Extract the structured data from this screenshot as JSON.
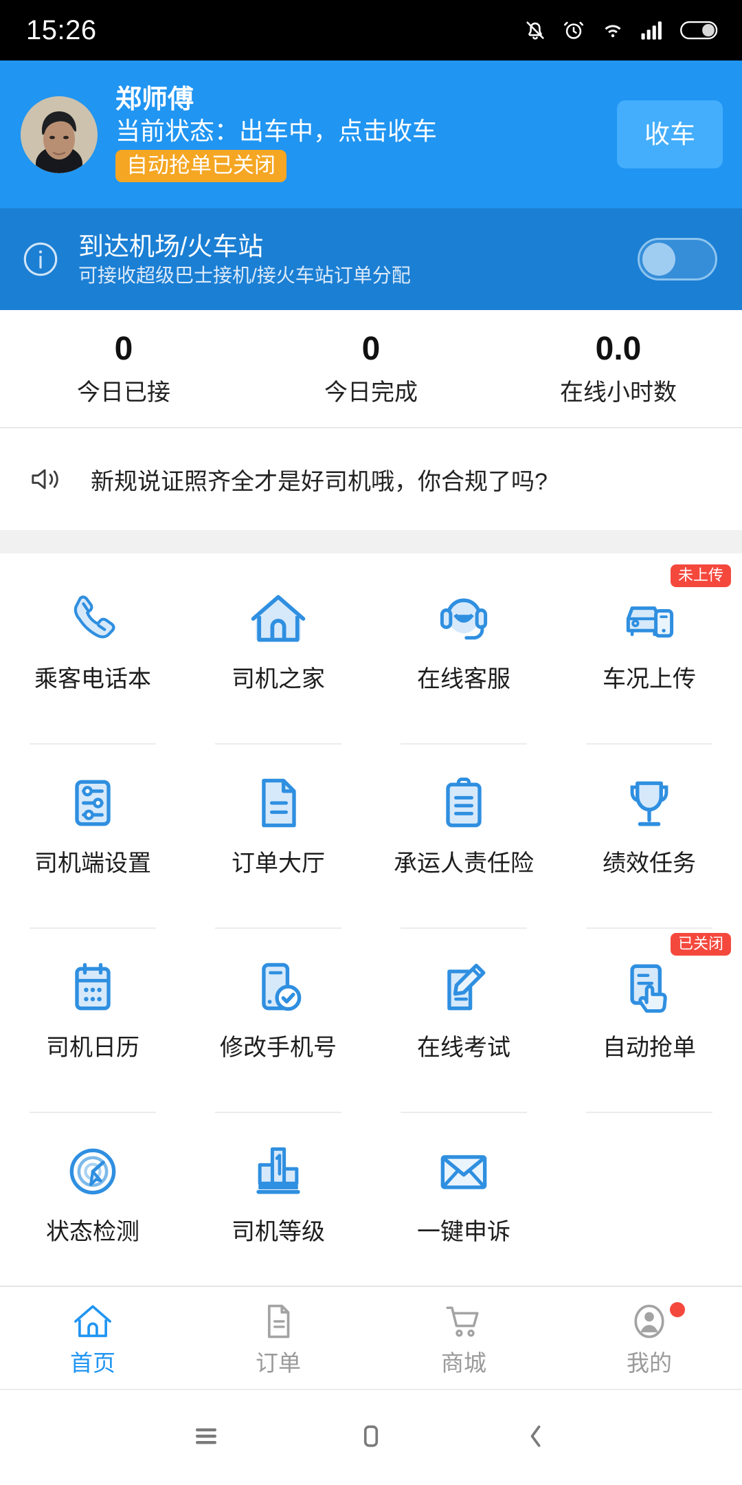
{
  "statusbar": {
    "clock": "15:26",
    "icons": [
      "bell-muted-icon",
      "alarm-clock-icon",
      "wifi-icon",
      "signal-bars-icon",
      "battery-icon"
    ]
  },
  "driver_header": {
    "name": "郑师傅",
    "status_text": "当前状态：出车中，点击收车",
    "auto_grab_badge": "自动抢单已关闭",
    "collect_button": "收车",
    "background_color": "#2095f2",
    "badge_color": "#f5a623"
  },
  "airport_banner": {
    "title": "到达机场/火车站",
    "subtitle": "可接收超级巴士接机/接火车站订单分配",
    "toggle_on": false,
    "background_color": "#1b7fd4"
  },
  "stats": [
    {
      "value": "0",
      "label": "今日已接"
    },
    {
      "value": "0",
      "label": "今日完成"
    },
    {
      "value": "0.0",
      "label": "在线小时数"
    }
  ],
  "announcement": {
    "icon": "speaker-icon",
    "text": "新规说证照齐全才是好司机哦，你合规了吗?"
  },
  "grid": [
    {
      "label": "乘客电话本",
      "icon": "phone-icon",
      "tag": null
    },
    {
      "label": "司机之家",
      "icon": "home-icon",
      "tag": null
    },
    {
      "label": "在线客服",
      "icon": "headset-icon",
      "tag": null
    },
    {
      "label": "车况上传",
      "icon": "car-upload-icon",
      "tag": "未上传"
    },
    {
      "label": "司机端设置",
      "icon": "sliders-icon",
      "tag": null
    },
    {
      "label": "订单大厅",
      "icon": "document-icon",
      "tag": null
    },
    {
      "label": "承运人责任险",
      "icon": "clipboard-icon",
      "tag": null
    },
    {
      "label": "绩效任务",
      "icon": "trophy-icon",
      "tag": null
    },
    {
      "label": "司机日历",
      "icon": "calendar-icon",
      "tag": null
    },
    {
      "label": "修改手机号",
      "icon": "phone-check-icon",
      "tag": null
    },
    {
      "label": "在线考试",
      "icon": "edit-pencil-icon",
      "tag": null
    },
    {
      "label": "自动抢单",
      "icon": "tap-hand-icon",
      "tag": "已关闭"
    },
    {
      "label": "状态检测",
      "icon": "radar-touch-icon",
      "tag": null
    },
    {
      "label": "司机等级",
      "icon": "podium-icon",
      "tag": null
    },
    {
      "label": "一键申诉",
      "icon": "envelope-icon",
      "tag": null
    },
    {
      "label": "",
      "icon": null,
      "tag": null
    }
  ],
  "tabbar": [
    {
      "label": "首页",
      "icon": "home-icon",
      "active": true,
      "badge": false
    },
    {
      "label": "订单",
      "icon": "document-icon",
      "active": false,
      "badge": false
    },
    {
      "label": "商城",
      "icon": "cart-icon",
      "active": false,
      "badge": false
    },
    {
      "label": "我的",
      "icon": "person-icon",
      "active": false,
      "badge": true
    }
  ],
  "android_nav": [
    "recents-icon",
    "home-square-icon",
    "back-chevron-icon"
  ],
  "colors": {
    "accent": "#2095f2",
    "badge_red": "#f5483d",
    "badge_orange": "#f5a623",
    "icon_blue": "#2f8fe0"
  }
}
